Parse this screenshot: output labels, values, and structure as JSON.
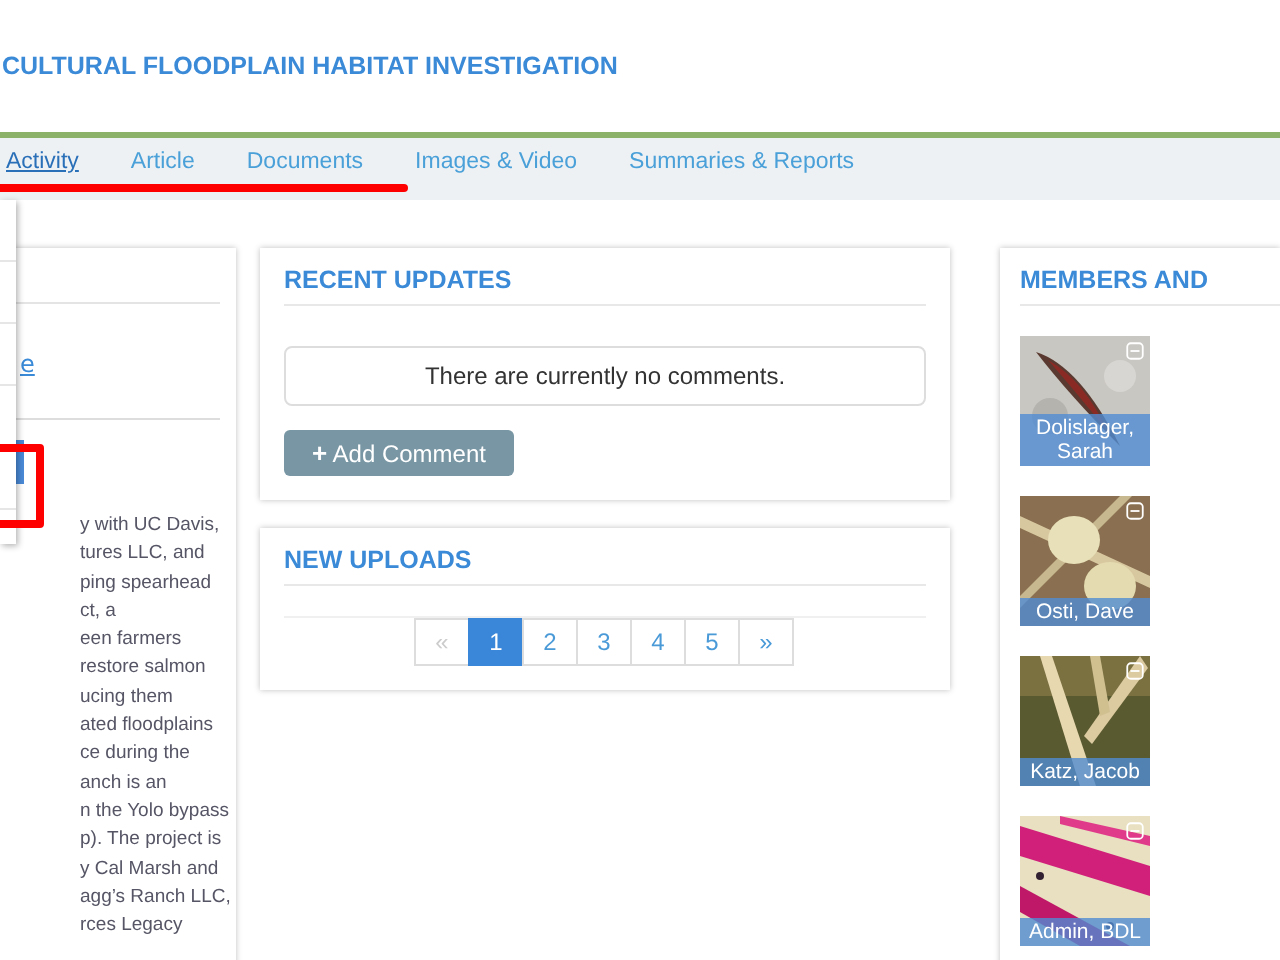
{
  "header": {
    "title": "CULTURAL FLOODPLAIN HABITAT INVESTIGATION"
  },
  "tabs": [
    {
      "label": "Activity",
      "selected": true
    },
    {
      "label": "Article",
      "selected": false
    },
    {
      "label": "Documents",
      "selected": false
    },
    {
      "label": "Images & Video",
      "selected": false
    },
    {
      "label": "Summaries & Reports",
      "selected": false
    }
  ],
  "left_card": {
    "link": "e",
    "paragraph_lines": [
      "y with UC Davis,",
      "tures LLC, and",
      "ping spearhead",
      "ct, a",
      "een farmers",
      "restore salmon",
      "ucing them",
      "ated floodplains",
      "ce during the",
      "anch is an",
      "n the Yolo bypass",
      "p). The project is",
      "y Cal Marsh and",
      "agg’s Ranch LLC,",
      "rces Legacy"
    ]
  },
  "recent_updates": {
    "title": "RECENT UPDATES",
    "empty_message": "There are currently no comments.",
    "button": {
      "icon": "+",
      "label": "Add Comment"
    }
  },
  "new_uploads": {
    "title": "NEW UPLOADS",
    "pagination": [
      {
        "label": "«",
        "selected": false,
        "disabled": true
      },
      {
        "label": "1",
        "selected": true,
        "disabled": false
      },
      {
        "label": "2",
        "selected": false,
        "disabled": false
      },
      {
        "label": "3",
        "selected": false,
        "disabled": false
      },
      {
        "label": "4",
        "selected": false,
        "disabled": false
      },
      {
        "label": "5",
        "selected": false,
        "disabled": false
      },
      {
        "label": "»",
        "selected": false,
        "disabled": false
      }
    ]
  },
  "members": {
    "title": "MEMBERS AND",
    "items": [
      {
        "name": "Dolislager, Sarah",
        "kind": "feather"
      },
      {
        "name": "Osti, Dave",
        "kind": "eggs"
      },
      {
        "name": "Katz, Jacob",
        "kind": "branches"
      },
      {
        "name": "Admin, BDL",
        "kind": "pink"
      }
    ]
  }
}
